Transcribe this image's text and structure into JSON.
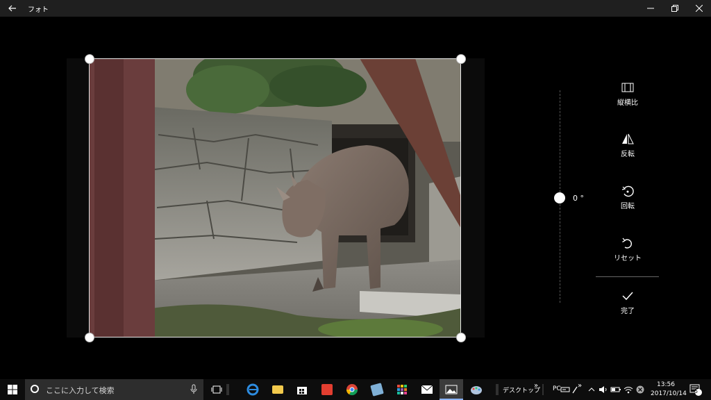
{
  "window": {
    "title": "フォト",
    "back_icon": "back-arrow-icon",
    "controls": [
      "minimize-icon",
      "restore-icon",
      "close-icon"
    ]
  },
  "editor": {
    "photo": {
      "description_icon": "rhinoceros-photo"
    },
    "rotation": {
      "value": "0 °"
    },
    "tools": {
      "aspect": {
        "label": "縦横比",
        "icon": "aspect-ratio-icon"
      },
      "flip": {
        "label": "反転",
        "icon": "flip-icon"
      },
      "rotate": {
        "label": "回転",
        "icon": "rotate-icon"
      },
      "reset": {
        "label": "リセット",
        "icon": "reset-icon"
      },
      "done": {
        "label": "完了",
        "icon": "checkmark-icon"
      }
    }
  },
  "taskbar": {
    "search_placeholder": "ここに入力して検索",
    "desktop_label": "デスクトップ",
    "desktop_chevron": "»",
    "pc_label": "PC",
    "tray_chevron": "»",
    "time": "13:56",
    "date": "2017/10/14",
    "notification_count": "5",
    "apps": [
      "task-view",
      "edge",
      "file-explorer",
      "store",
      "red-app",
      "chrome",
      "notes",
      "grid-app",
      "mail",
      "photos",
      "paint"
    ]
  },
  "colors": {
    "accent": "#8ab4f8",
    "titlebar": "#1f1f1f",
    "taskbar": "#0d0d0d"
  }
}
